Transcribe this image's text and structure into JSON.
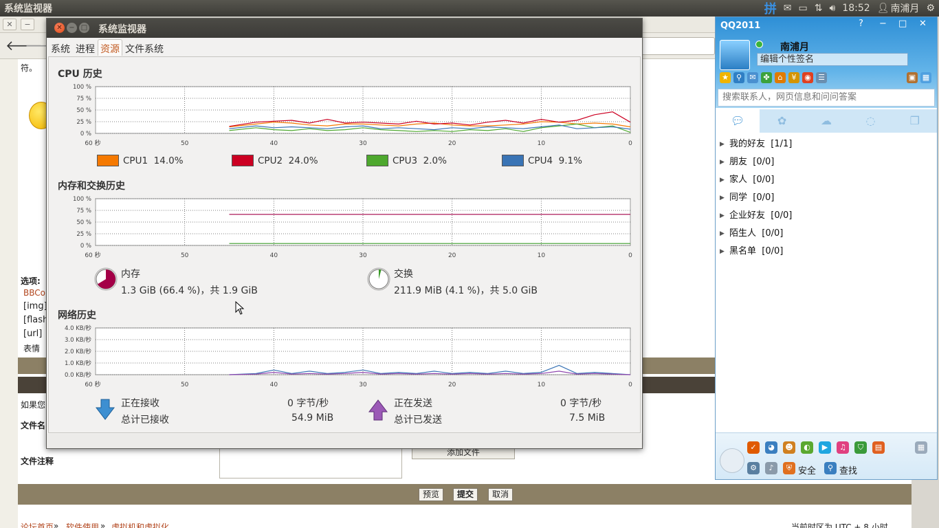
{
  "top_panel": {
    "title": "系统监视器",
    "ime_icon": "拼",
    "time": "18:52",
    "user": "南浦月"
  },
  "browser": {
    "partial_text": "符。",
    "options_label": "选项:",
    "bbcode": "BBCo",
    "img_tag": "[img]",
    "flash_tag": "[flash",
    "url_tag": "[url]",
    "emoticon": "表情",
    "if_you": "如果您",
    "file_name_label": "文件名",
    "file_note_label": "文件注释",
    "add_file": "添加文件",
    "preview": "预览",
    "submit": "提交",
    "cancel": "取消",
    "breadcrumb": [
      "论坛首页",
      "软件使用",
      "虚拟机和虚拟化"
    ],
    "timezone": "当前时区为 UTC + 8 小时"
  },
  "sysmon": {
    "window_title": "系统监视器",
    "tabs": [
      "系统",
      "进程",
      "资源",
      "文件系统"
    ],
    "cpu_title": "CPU 历史",
    "mem_title": "内存和交换历史",
    "net_title": "网络历史",
    "pct_ticks": [
      "100 %",
      "75 %",
      "50 %",
      "25 %",
      "0 %"
    ],
    "net_ticks": [
      "4.0 KB/秒",
      "3.0 KB/秒",
      "2.0 KB/秒",
      "1.0 KB/秒",
      "0.0 KB/秒"
    ],
    "time_ticks": [
      "60 秒",
      "50",
      "40",
      "30",
      "20",
      "10",
      "0"
    ],
    "cpus": [
      {
        "label": "CPU1",
        "value": "14.0%",
        "color": "#f57900"
      },
      {
        "label": "CPU2",
        "value": "24.0%",
        "color": "#cc0022"
      },
      {
        "label": "CPU3",
        "value": "2.0%",
        "color": "#4ea82e"
      },
      {
        "label": "CPU4",
        "value": "9.1%",
        "color": "#3a74b5"
      }
    ],
    "memory": {
      "label": "内存",
      "value": "1.3 GiB (66.4 %)，共 1.9 GiB",
      "fraction": 0.664,
      "color": "#a40047"
    },
    "swap": {
      "label": "交换",
      "value": "211.9 MiB (4.1 %)，共 5.0 GiB",
      "fraction": 0.041,
      "color": "#3a9a28"
    },
    "network": {
      "receiving_label": "正在接收",
      "receiving_value": "0 字节/秒",
      "total_recv_label": "总计已接收",
      "total_recv_value": "54.9 MiB",
      "sending_label": "正在发送",
      "sending_value": "0 字节/秒",
      "total_sent_label": "总计已发送",
      "total_sent_value": "7.5 MiB"
    }
  },
  "chart_data": [
    {
      "type": "line",
      "title": "CPU 历史",
      "x": [
        45,
        42,
        40,
        38,
        36,
        34,
        32,
        30,
        28,
        26,
        24,
        22,
        20,
        18,
        16,
        14,
        12,
        10,
        8,
        6,
        4,
        2,
        0
      ],
      "ylim": [
        0,
        100
      ],
      "xlim": [
        60,
        0
      ],
      "grid": true,
      "series": [
        {
          "name": "CPU1",
          "values": [
            14,
            20,
            24,
            22,
            18,
            16,
            20,
            20,
            18,
            16,
            20,
            22,
            18,
            16,
            16,
            18,
            20,
            25,
            24,
            20,
            22,
            20,
            14
          ]
        },
        {
          "name": "CPU2",
          "values": [
            15,
            24,
            26,
            28,
            22,
            30,
            22,
            24,
            22,
            20,
            26,
            20,
            22,
            18,
            24,
            28,
            22,
            30,
            24,
            28,
            40,
            46,
            24
          ]
        },
        {
          "name": "CPU3",
          "values": [
            6,
            12,
            8,
            6,
            10,
            6,
            8,
            12,
            8,
            6,
            4,
            6,
            4,
            8,
            6,
            10,
            4,
            12,
            16,
            20,
            12,
            16,
            2
          ]
        },
        {
          "name": "CPU4",
          "values": [
            10,
            16,
            12,
            14,
            12,
            10,
            14,
            16,
            10,
            12,
            10,
            8,
            12,
            10,
            14,
            12,
            10,
            14,
            18,
            10,
            12,
            14,
            9
          ]
        }
      ]
    },
    {
      "type": "line",
      "title": "内存和交换历史",
      "x": [
        45,
        40,
        30,
        20,
        10,
        0
      ],
      "ylim": [
        0,
        100
      ],
      "xlim": [
        60,
        0
      ],
      "grid": true,
      "series": [
        {
          "name": "内存",
          "values": [
            66.4,
            66.4,
            66.4,
            66.4,
            66.4,
            66.4
          ]
        },
        {
          "name": "交换",
          "values": [
            4.1,
            4.1,
            4.1,
            4.1,
            4.1,
            4.1
          ]
        }
      ]
    },
    {
      "type": "line",
      "title": "网络历史",
      "x": [
        45,
        42,
        40,
        38,
        36,
        34,
        32,
        30,
        28,
        26,
        24,
        22,
        20,
        18,
        16,
        14,
        12,
        10,
        8,
        6,
        4,
        2,
        0
      ],
      "ylim": [
        0,
        4.0
      ],
      "xlim": [
        60,
        0
      ],
      "grid": true,
      "series": [
        {
          "name": "正在接收",
          "values": [
            0,
            0.1,
            0.4,
            0.1,
            0.3,
            0.1,
            0.2,
            0.4,
            0.1,
            0.2,
            0.1,
            0.3,
            0.1,
            0.2,
            0.1,
            0.3,
            0.1,
            0.2,
            0.8,
            0.1,
            0.2,
            0.1,
            0
          ]
        },
        {
          "name": "正在发送",
          "values": [
            0,
            0.05,
            0.2,
            0.05,
            0.1,
            0.05,
            0.1,
            0.2,
            0.05,
            0.1,
            0.05,
            0.1,
            0.05,
            0.1,
            0.05,
            0.1,
            0.05,
            0.1,
            0.3,
            0.05,
            0.1,
            0.05,
            0
          ]
        }
      ]
    }
  ],
  "qq": {
    "title": "QQ2011",
    "name": "南浦月",
    "signature": "编辑个性签名",
    "search_placeholder": "搜索联系人，网页信息和问问答案",
    "groups": [
      {
        "name": "我的好友",
        "count": "[1/1]"
      },
      {
        "name": "朋友",
        "count": "[0/0]"
      },
      {
        "name": "家人",
        "count": "[0/0]"
      },
      {
        "name": "同学",
        "count": "[0/0]"
      },
      {
        "name": "企业好友",
        "count": "[0/0]"
      },
      {
        "name": "陌生人",
        "count": "[0/0]"
      },
      {
        "name": "黑名单",
        "count": "[0/0]"
      }
    ],
    "security": "安全",
    "find": "查找"
  }
}
